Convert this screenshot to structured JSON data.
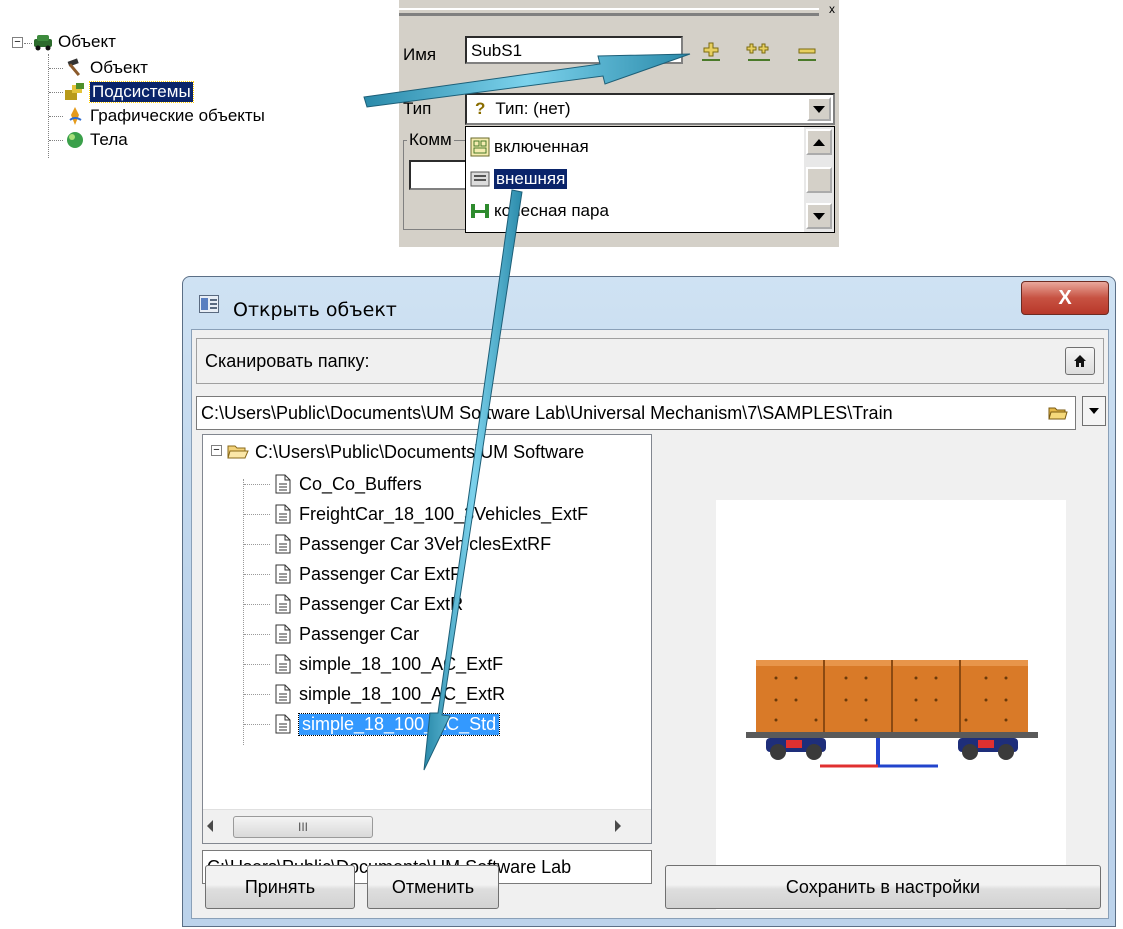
{
  "object_tree": {
    "root_label": "Объект",
    "items": [
      {
        "label": "Объект",
        "icon": "hammer-icon"
      },
      {
        "label": "Подсистемы",
        "icon": "subsystems-icon"
      },
      {
        "label": "Графические объекты",
        "icon": "graphics-icon"
      },
      {
        "label": "Тела",
        "icon": "bodies-icon"
      }
    ]
  },
  "subsystem_panel": {
    "name_label": "Имя",
    "name_value": "SubS1",
    "type_label": "Тип",
    "type_value": "Тип: (нет)",
    "comment_label": "Комм",
    "type_options": [
      {
        "label": "включенная",
        "icon": "included-icon"
      },
      {
        "label": "внешняя",
        "icon": "external-icon"
      },
      {
        "label": "колесная пара",
        "icon": "wheelset-icon"
      }
    ]
  },
  "dialog": {
    "title": "Открыть объект",
    "scan_label": "Сканировать папку:",
    "path": "C:\\Users\\Public\\Documents\\UM Software Lab\\Universal Mechanism\\7\\SAMPLES\\Train",
    "tree_root": "C:\\Users\\Public\\Documents\\UM Software",
    "files": [
      "Co_Co_Buffers",
      "FreightCar_18_100_3Vehicles_ExtF",
      "Passenger Car 3VehiclesExtRF",
      "Passenger Car ExtF",
      "Passenger Car ExtR",
      "Passenger Car",
      "simple_18_100_AC_ExtF",
      "simple_18_100_AC_ExtR",
      "simple_18_100_AC_Std"
    ],
    "selected_file_index": 8,
    "scroll_thumb_label": "III",
    "selected_path": "C:\\Users\\Public\\Documents\\UM Software Lab",
    "accept_label": "Принять",
    "cancel_label": "Отменить",
    "save_label": "Сохранить в настройки",
    "close_label": "X"
  },
  "colors": {
    "selection_dark": "#0a246a",
    "selection_blue": "#3399ff",
    "arrow": "#4aa3c7",
    "wagon_body": "#d97a28",
    "dialog_frame": "#b9d1ea",
    "close_button": "#c75242"
  }
}
